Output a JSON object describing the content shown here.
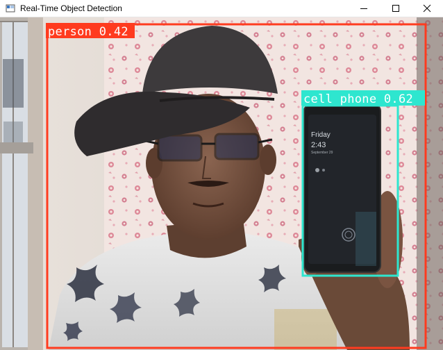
{
  "window": {
    "title": "Real-Time Object Detection",
    "controls": {
      "minimize": "minimize-icon",
      "maximize": "maximize-icon",
      "close": "close-icon"
    }
  },
  "detections": [
    {
      "label": "person 0.42",
      "color": "#ff3b1f",
      "text_color": "#ffffff"
    },
    {
      "label": "cell phone 0.62",
      "color": "#2ee6cf",
      "text_color": "#ffffff"
    }
  ],
  "phone_screen": {
    "day": "Friday",
    "time": "2:43",
    "date": "September 29"
  }
}
